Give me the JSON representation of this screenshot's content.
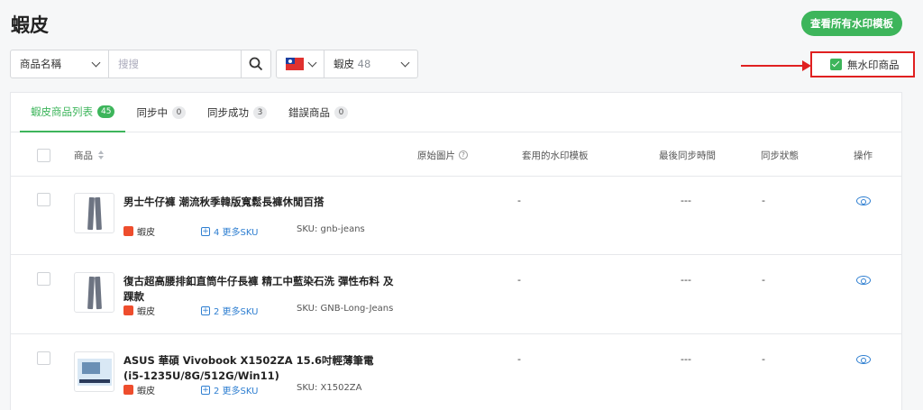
{
  "page": {
    "title": "蝦皮"
  },
  "header": {
    "view_templates_button": "查看所有水印模板"
  },
  "filters": {
    "field_select": "商品名稱",
    "search_placeholder": "搜搜",
    "country_flag": "taiwan-flag-icon",
    "platform": "蝦皮",
    "platform_count": "48"
  },
  "no_watermark": {
    "label": "無水印商品",
    "checked": true
  },
  "tabs": [
    {
      "label": "蝦皮商品列表",
      "count": "45",
      "active": true
    },
    {
      "label": "同步中",
      "count": "0"
    },
    {
      "label": "同步成功",
      "count": "3"
    },
    {
      "label": "錯誤商品",
      "count": "0"
    }
  ],
  "table": {
    "headers": {
      "product": "商品",
      "original_image": "原始圖片",
      "applied_template": "套用的水印模板",
      "last_sync_time": "最後同步時間",
      "sync_status": "同步狀態",
      "actions": "操作"
    },
    "rows": [
      {
        "name": "男士牛仔褲 潮流秋季韓版寬鬆長褲休閒百搭",
        "shop": "蝦皮",
        "more_sku": "4 更多SKU",
        "sku": "SKU: gnb-jeans",
        "original_image": "-",
        "template": "",
        "last_sync": "---",
        "status": "-",
        "thumb": "jeans"
      },
      {
        "name": "復古超高腰排釦直筒牛仔長褲 精工中藍染石洗 彈性布料 及踝款",
        "shop": "蝦皮",
        "more_sku": "2 更多SKU",
        "sku": "SKU: GNB-Long-Jeans",
        "original_image": "-",
        "template": "",
        "last_sync": "---",
        "status": "-",
        "thumb": "jeans"
      },
      {
        "name": "ASUS 華碩 Vivobook X1502ZA 15.6吋輕薄筆電 (i5-1235U/8G/512G/Win11)",
        "shop": "蝦皮",
        "more_sku": "2 更多SKU",
        "sku": "SKU: X1502ZA",
        "original_image": "-",
        "template": "",
        "last_sync": "---",
        "status": "-",
        "thumb": "laptop"
      }
    ]
  },
  "colors": {
    "accent": "#3db55b",
    "link": "#2f7fd1",
    "highlight": "#e02020"
  }
}
